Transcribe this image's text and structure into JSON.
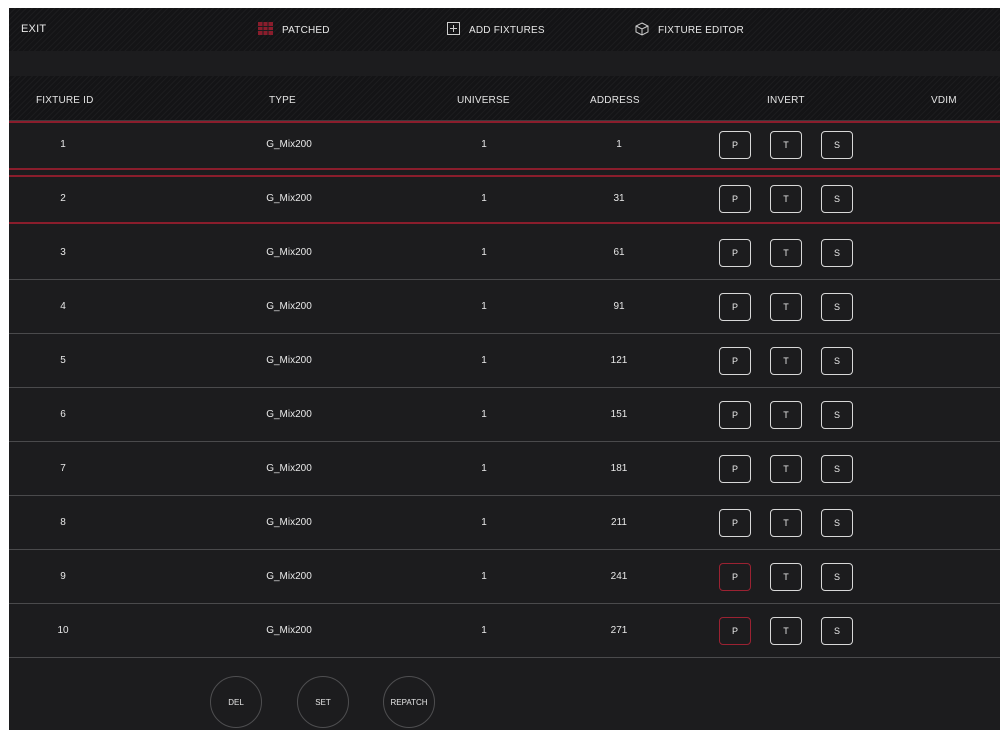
{
  "topbar": {
    "exit": "EXIT",
    "patched": "PATCHED",
    "add_fixtures": "ADD FIXTURES",
    "fixture_editor": "FIXTURE EDITOR"
  },
  "columns": {
    "fixture_id": "FIXTURE ID",
    "type": "TYPE",
    "universe": "UNIVERSE",
    "address": "ADDRESS",
    "invert": "INVERT",
    "vdim": "VDIM"
  },
  "invert_labels": {
    "p": "P",
    "t": "T",
    "s": "S"
  },
  "rows": [
    {
      "id": "1",
      "type": "G_Mix200",
      "universe": "1",
      "address": "1",
      "p_active": false
    },
    {
      "id": "2",
      "type": "G_Mix200",
      "universe": "1",
      "address": "31",
      "p_active": false
    },
    {
      "id": "3",
      "type": "G_Mix200",
      "universe": "1",
      "address": "61",
      "p_active": false
    },
    {
      "id": "4",
      "type": "G_Mix200",
      "universe": "1",
      "address": "91",
      "p_active": false
    },
    {
      "id": "5",
      "type": "G_Mix200",
      "universe": "1",
      "address": "121",
      "p_active": false
    },
    {
      "id": "6",
      "type": "G_Mix200",
      "universe": "1",
      "address": "151",
      "p_active": false
    },
    {
      "id": "7",
      "type": "G_Mix200",
      "universe": "1",
      "address": "181",
      "p_active": false
    },
    {
      "id": "8",
      "type": "G_Mix200",
      "universe": "1",
      "address": "211",
      "p_active": false
    },
    {
      "id": "9",
      "type": "G_Mix200",
      "universe": "1",
      "address": "241",
      "p_active": true
    },
    {
      "id": "10",
      "type": "G_Mix200",
      "universe": "1",
      "address": "271",
      "p_active": true
    }
  ],
  "selected_rows": [
    "1",
    "2"
  ],
  "footer": {
    "del": "DEL",
    "set": "SET",
    "repatch": "REPATCH"
  },
  "colors": {
    "accent": "#8a1d2c",
    "background": "#1c1c1e",
    "header": "#141416"
  },
  "icons": {
    "patched": "grid-icon",
    "add_fixtures": "plus-box-icon",
    "fixture_editor": "cube-icon"
  }
}
